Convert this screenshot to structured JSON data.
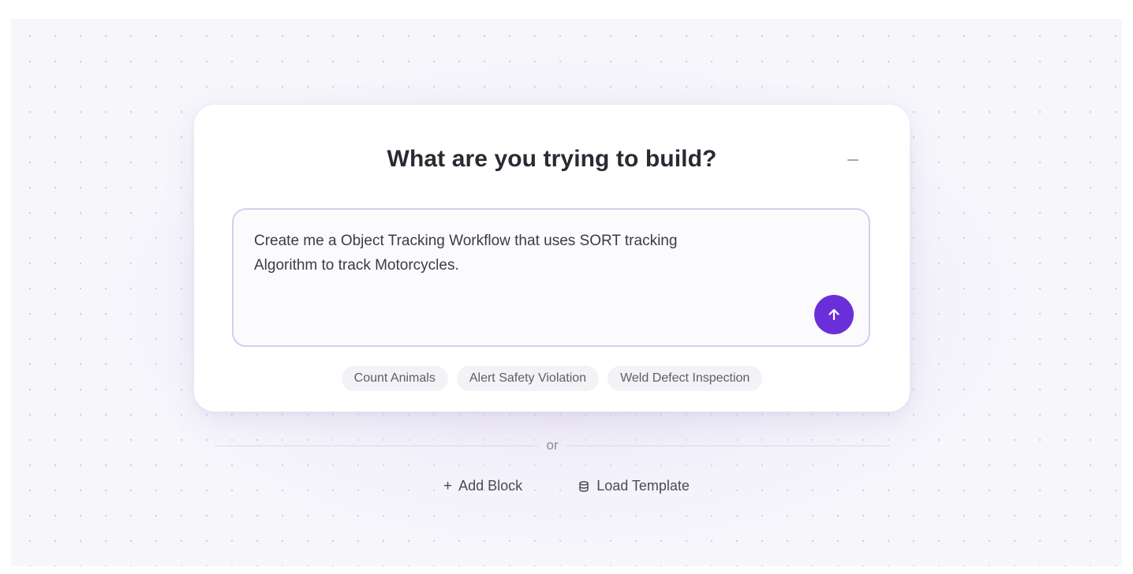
{
  "prompt_panel": {
    "title": "What are you trying to build?",
    "input_value": "Create me a Object Tracking Workflow that uses SORT tracking\nAlgorithm to track Motorcycles.",
    "send_icon": "arrow-up-icon",
    "minimize_icon": "minus-icon"
  },
  "suggestions": [
    {
      "label": "Count Animals"
    },
    {
      "label": "Alert Safety Violation"
    },
    {
      "label": "Weld Defect Inspection"
    }
  ],
  "divider": {
    "label": "or"
  },
  "actions": {
    "add_block": {
      "label": "Add Block",
      "icon": "plus-icon"
    },
    "load_template": {
      "label": "Load Template",
      "icon": "template-stack-icon"
    }
  },
  "colors": {
    "accent": "#6a2fd9",
    "input_border": "#d6cdf0",
    "background": "#f7f6fb"
  }
}
